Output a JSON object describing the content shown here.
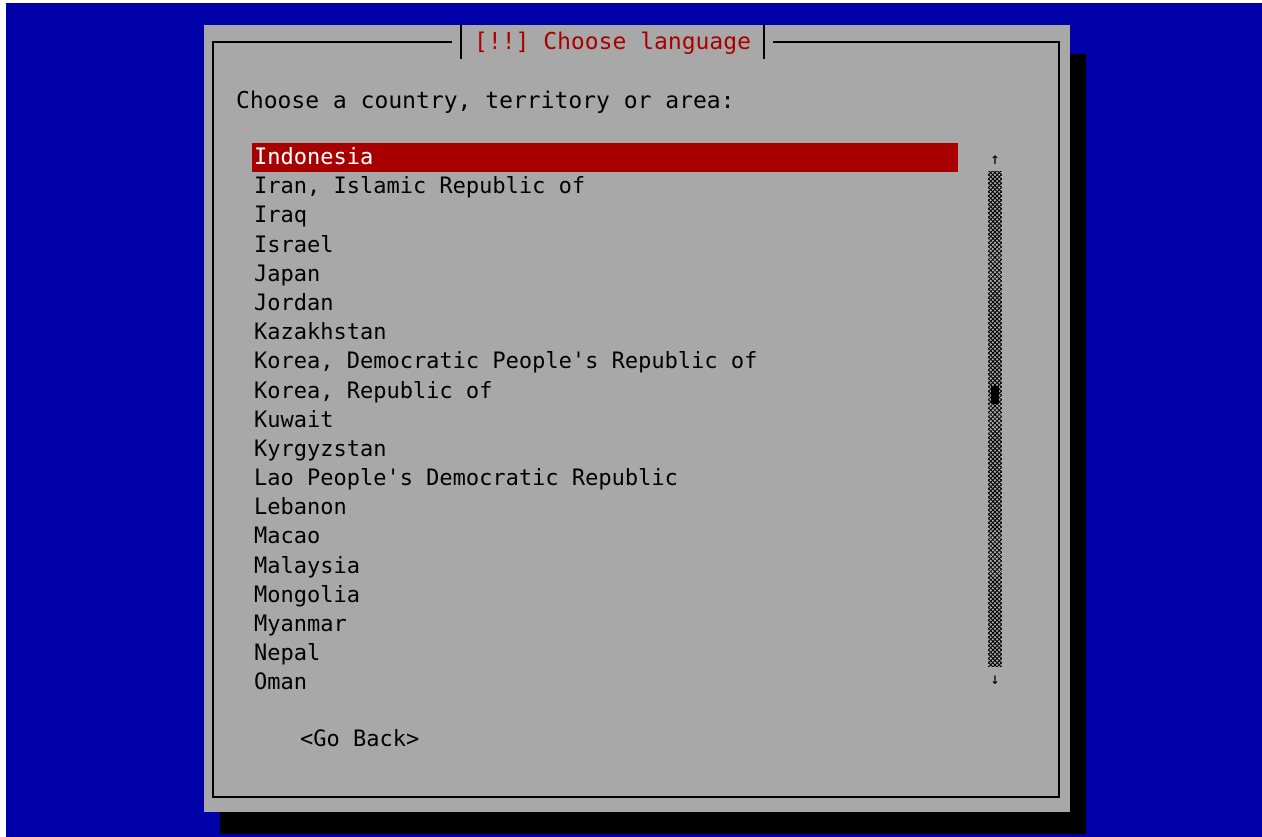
{
  "dialog": {
    "title": "[!!] Choose language",
    "prompt": "Choose a country, territory or area:",
    "go_back_label": "<Go Back>"
  },
  "countries": [
    "Indonesia",
    "Iran, Islamic Republic of",
    "Iraq",
    "Israel",
    "Japan",
    "Jordan",
    "Kazakhstan",
    "Korea, Democratic People's Republic of",
    "Korea, Republic of",
    "Kuwait",
    "Kyrgyzstan",
    "Lao People's Democratic Republic",
    "Lebanon",
    "Macao",
    "Malaysia",
    "Mongolia",
    "Myanmar",
    "Nepal",
    "Oman"
  ],
  "selected_country": "Indonesia",
  "scrollbar": {
    "up_arrow": "↑",
    "down_arrow": "↓",
    "position": 0.45
  },
  "colors": {
    "background": "#0000a8",
    "dialog": "#a8a8a8",
    "title": "#a80000",
    "selection": "#a80000",
    "selected_text": "#ffffff",
    "shadow": "#000000"
  }
}
